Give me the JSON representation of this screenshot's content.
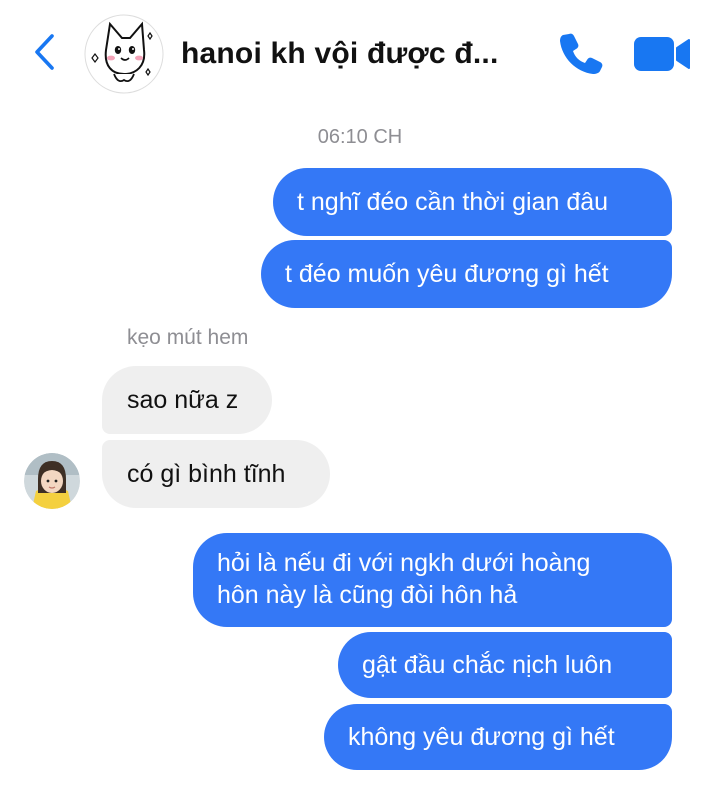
{
  "header": {
    "title": "hanoi kh vội được đ...",
    "back_icon": "chevron-left-icon",
    "call_icon": "phone-icon",
    "video_icon": "video-camera-icon",
    "accent_color": "#1877f2"
  },
  "conversation": {
    "timestamp": "06:10 CH",
    "sender_name": "kẹo mút hem",
    "messages": [
      {
        "direction": "outgoing",
        "text": "t nghĩ đéo cần thời gian đâu"
      },
      {
        "direction": "outgoing",
        "text": "t đéo muốn yêu đương gì hết"
      },
      {
        "direction": "incoming",
        "text": "sao nữa z"
      },
      {
        "direction": "incoming",
        "text": "có gì bình tĩnh"
      },
      {
        "direction": "outgoing",
        "lines": [
          "hỏi là nếu đi với ngkh dưới hoàng",
          "hôn này là cũng đòi hôn hả"
        ]
      },
      {
        "direction": "outgoing",
        "text": "gật đầu chắc nịch luôn"
      },
      {
        "direction": "outgoing",
        "text": "không yêu đương gì hết"
      }
    ],
    "outgoing_color": "#3478f6",
    "incoming_color": "#efefef"
  }
}
